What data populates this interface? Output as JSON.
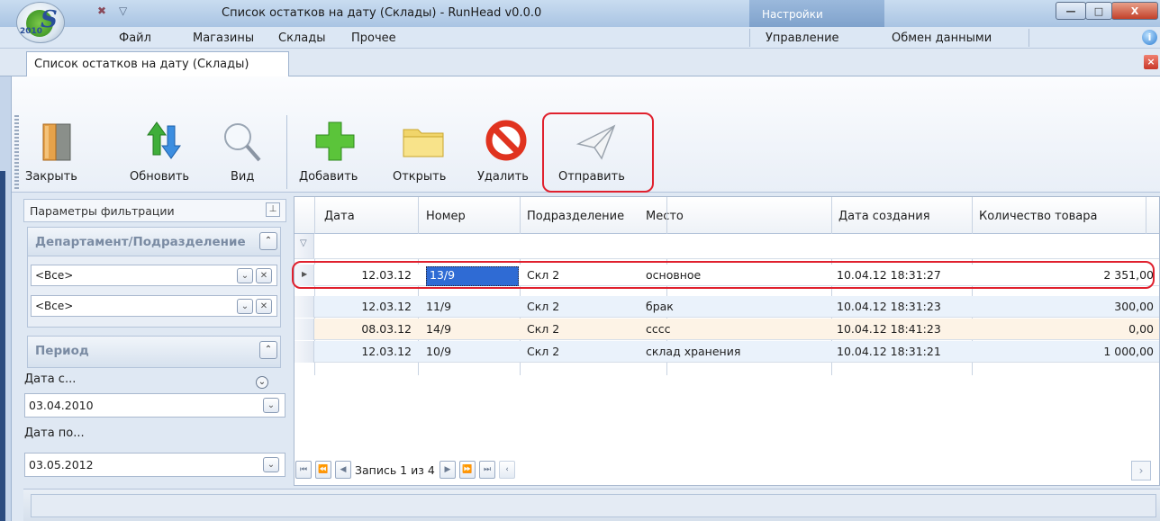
{
  "window": {
    "title": "Список остатков на дату (Склады) - RunHead v0.0.0",
    "context_tab": "Настройки",
    "logo_year": "2010",
    "logo_letter": "S",
    "controls": {
      "minimize": "—",
      "maximize": "□",
      "close": "X"
    }
  },
  "menu": {
    "items": [
      "Файл",
      "Магазины",
      "Склады",
      "Прочее"
    ],
    "right_items": [
      "Управление",
      "Обмен данными"
    ]
  },
  "document_tab": {
    "label": "Список остатков на дату (Склады)"
  },
  "toolbar": {
    "buttons": [
      {
        "label": "Закрыть",
        "icon": "door-exit-icon"
      },
      {
        "label": "Обновить",
        "icon": "refresh-arrows-icon"
      },
      {
        "label": "Вид",
        "icon": "magnifier-icon"
      },
      {
        "label": "Добавить",
        "icon": "green-plus-icon"
      },
      {
        "label": "Открыть",
        "icon": "folder-icon"
      },
      {
        "label": "Удалить",
        "icon": "no-entry-icon"
      },
      {
        "label": "Отправить",
        "icon": "paper-plane-icon",
        "highlighted": true
      }
    ]
  },
  "filter_panel": {
    "title": "Параметры фильтрации",
    "department_group": {
      "title": "Департамент/Подразделение",
      "combos": [
        "<Все>",
        "<Все>"
      ]
    },
    "period_group": {
      "title": "Период",
      "date_from_label": "Дата с...",
      "date_from_value": "03.04.2010",
      "date_to_label": "Дата по...",
      "date_to_value": "03.05.2012"
    }
  },
  "grid": {
    "columns": [
      "Дата",
      "Номер",
      "Подразделение",
      "Место",
      "Дата создания",
      "Количество товара"
    ],
    "rows": [
      {
        "date": "12.03.12",
        "number": "13/9",
        "division": "Скл 2",
        "place": "основное",
        "created": "10.04.12 18:31:27",
        "qty": "2 351,00",
        "selected": true
      },
      {
        "date": "12.03.12",
        "number": "11/9",
        "division": "Скл 2",
        "place": "брак",
        "created": "10.04.12 18:31:23",
        "qty": "300,00"
      },
      {
        "date": "08.03.12",
        "number": "14/9",
        "division": "Скл 2",
        "place": "сссс",
        "created": "10.04.12 18:41:23",
        "qty": "0,00"
      },
      {
        "date": "12.03.12",
        "number": "10/9",
        "division": "Скл 2",
        "place": "склад хранения",
        "created": "10.04.12 18:31:21",
        "qty": "1 000,00"
      }
    ],
    "navigator_text": "Запись 1 из 4"
  },
  "colors": {
    "highlight_red": "#e0212e",
    "selection_blue": "#2f6bd4",
    "row_alt_peach": "#fdf3e6",
    "row_alt_blue": "#eaf2fb"
  }
}
